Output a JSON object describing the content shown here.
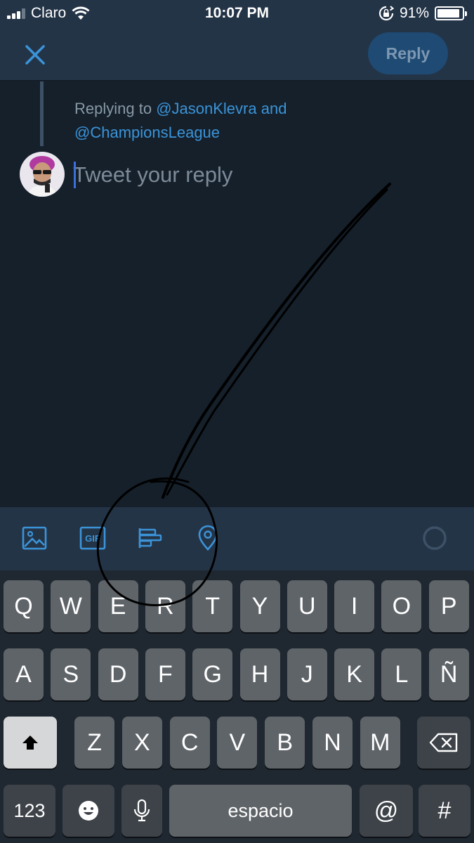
{
  "status_bar": {
    "carrier": "Claro",
    "time": "10:07 PM",
    "battery_text": "91%",
    "battery_level": 0.91,
    "icons": [
      "signal-bars-icon",
      "wifi-icon",
      "rotation-lock-icon",
      "battery-icon"
    ]
  },
  "nav": {
    "close_icon": "close-icon",
    "reply_label": "Reply"
  },
  "compose": {
    "replying_prefix": "Replying to",
    "handle_1": "@JasonKlevra",
    "conjunction": "and",
    "handle_2": "@ChampionsLeague",
    "placeholder": "Tweet your reply",
    "value": ""
  },
  "toolbar": {
    "icons": [
      "image-icon",
      "gif-icon",
      "poll-icon",
      "location-icon",
      "character-count-icon"
    ],
    "gif_text": "GIF"
  },
  "keyboard": {
    "row1": [
      "Q",
      "W",
      "E",
      "R",
      "T",
      "Y",
      "U",
      "I",
      "O",
      "P"
    ],
    "row2": [
      "A",
      "S",
      "D",
      "F",
      "G",
      "H",
      "J",
      "K",
      "L",
      "Ñ"
    ],
    "row3": [
      "Z",
      "X",
      "C",
      "V",
      "B",
      "N",
      "M"
    ],
    "numbers_key": "123",
    "space_key": "espacio",
    "at_key": "@",
    "hash_key": "#"
  },
  "colors": {
    "background": "#15202b",
    "bar": "#243447",
    "accent": "#3b94d9",
    "reply_button": "#1e4a73"
  }
}
